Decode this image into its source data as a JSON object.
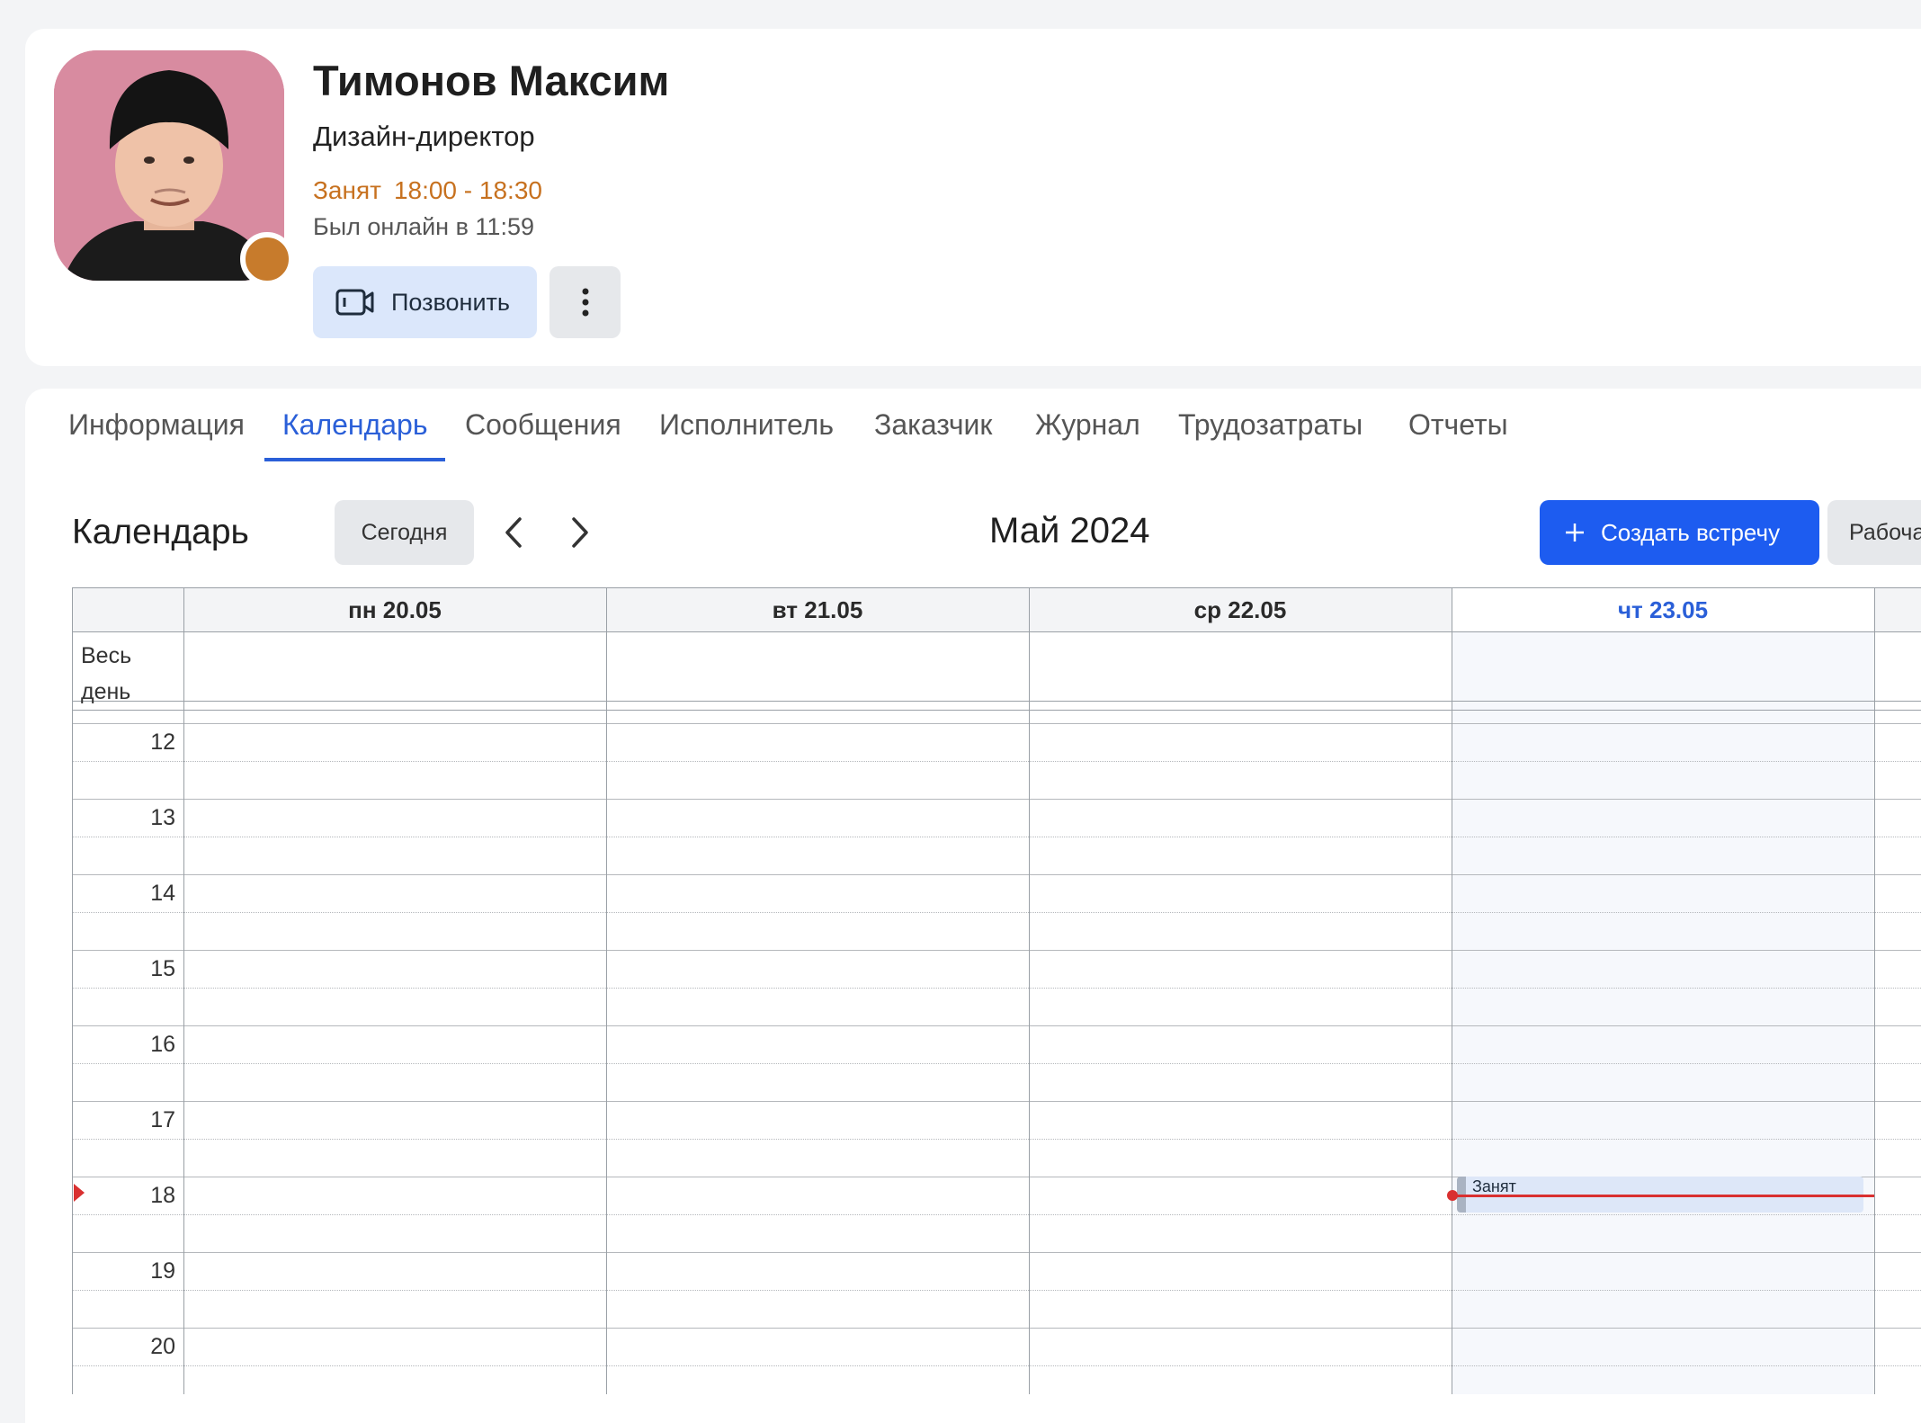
{
  "profile": {
    "name": "Тимонов Максим",
    "role": "Дизайн-директор",
    "status_label": "Занят",
    "status_time": "18:00 - 18:30",
    "last_online": "Был онлайн в 11:59",
    "call_label": "Позвонить",
    "status_color": "#c7711f"
  },
  "tabs": [
    {
      "label": "Информация",
      "active": false
    },
    {
      "label": "Календарь",
      "active": true
    },
    {
      "label": "Сообщения",
      "active": false
    },
    {
      "label": "Исполнитель",
      "active": false
    },
    {
      "label": "Заказчик",
      "active": false
    },
    {
      "label": "Журнал",
      "active": false
    },
    {
      "label": "Трудозатраты",
      "active": false
    },
    {
      "label": "Отчеты",
      "active": false
    }
  ],
  "calendar": {
    "title": "Календарь",
    "today_label": "Сегодня",
    "month": "Май 2024",
    "create_label": "Создать встречу",
    "view_label": "Рабоча",
    "all_day_label": "Весь день",
    "days": [
      {
        "label": "пн 20.05",
        "today": false
      },
      {
        "label": "вт 21.05",
        "today": false
      },
      {
        "label": "ср 22.05",
        "today": false
      },
      {
        "label": "чт 23.05",
        "today": true
      }
    ],
    "hours": [
      "12",
      "13",
      "14",
      "15",
      "16",
      "17",
      "18",
      "19",
      "20"
    ],
    "event": {
      "label": "Занят",
      "day": "чт 23.05",
      "start": "18:00",
      "end": "18:30"
    },
    "current_time_hour": "18"
  },
  "icons": {
    "call": "video-camera-icon",
    "more": "vertical-dots-icon",
    "prev": "chevron-left-icon",
    "next": "chevron-right-icon",
    "create": "plus-icon"
  },
  "colors": {
    "accent": "#2a5fd8",
    "primary_button": "#1d5cf0",
    "now_line": "#d93030",
    "status_dot": "#c77b2c"
  }
}
